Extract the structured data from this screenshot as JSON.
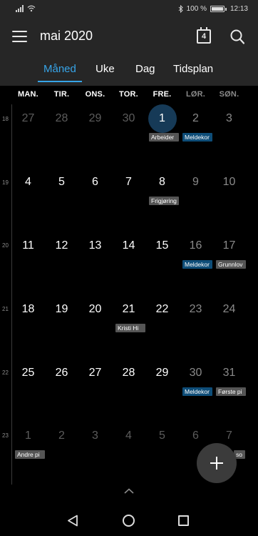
{
  "status_bar": {
    "battery_text": "100 %",
    "time": "12:13"
  },
  "app_bar": {
    "title": "mai 2020",
    "today_badge": "4"
  },
  "tabs": [
    {
      "label": "Måned",
      "active": true
    },
    {
      "label": "Uke",
      "active": false
    },
    {
      "label": "Dag",
      "active": false
    },
    {
      "label": "Tidsplan",
      "active": false
    }
  ],
  "weekdays": [
    "MAN.",
    "TIR.",
    "ONS.",
    "TOR.",
    "FRE.",
    "LØR.",
    "SØN."
  ],
  "weeks": [
    {
      "number": "18",
      "days": [
        "27",
        "28",
        "29",
        "30",
        "1",
        "2",
        "3"
      ]
    },
    {
      "number": "19",
      "days": [
        "4",
        "5",
        "6",
        "7",
        "8",
        "9",
        "10"
      ]
    },
    {
      "number": "20",
      "days": [
        "11",
        "12",
        "13",
        "14",
        "15",
        "16",
        "17"
      ]
    },
    {
      "number": "21",
      "days": [
        "18",
        "19",
        "20",
        "21",
        "22",
        "23",
        "24"
      ]
    },
    {
      "number": "22",
      "days": [
        "25",
        "26",
        "27",
        "28",
        "29",
        "30",
        "31"
      ]
    },
    {
      "number": "23",
      "days": [
        "1",
        "2",
        "3",
        "4",
        "5",
        "6",
        "7"
      ]
    }
  ],
  "events": {
    "w0_fri": "Arbeider",
    "w0_sat": "Meldekor",
    "w1_fri": "Frigjøring",
    "w2_sat": "Meldekor",
    "w2_sun": "Grunnlov",
    "w3_thu": "Kristi Hi",
    "w4_sat": "Meldekor",
    "w4_sun": "Første pi",
    "w5_mon": "Andre pi",
    "w5_sun": "so"
  },
  "colors": {
    "accent": "#37a4e8",
    "today_bg": "#163a57",
    "event_gray": "#555555",
    "event_blue": "#0e4d78"
  },
  "icons": {
    "menu": "hamburger-menu-icon",
    "today": "calendar-today-icon",
    "search": "search-icon",
    "add": "plus-icon",
    "expand": "chevron-up-icon"
  }
}
